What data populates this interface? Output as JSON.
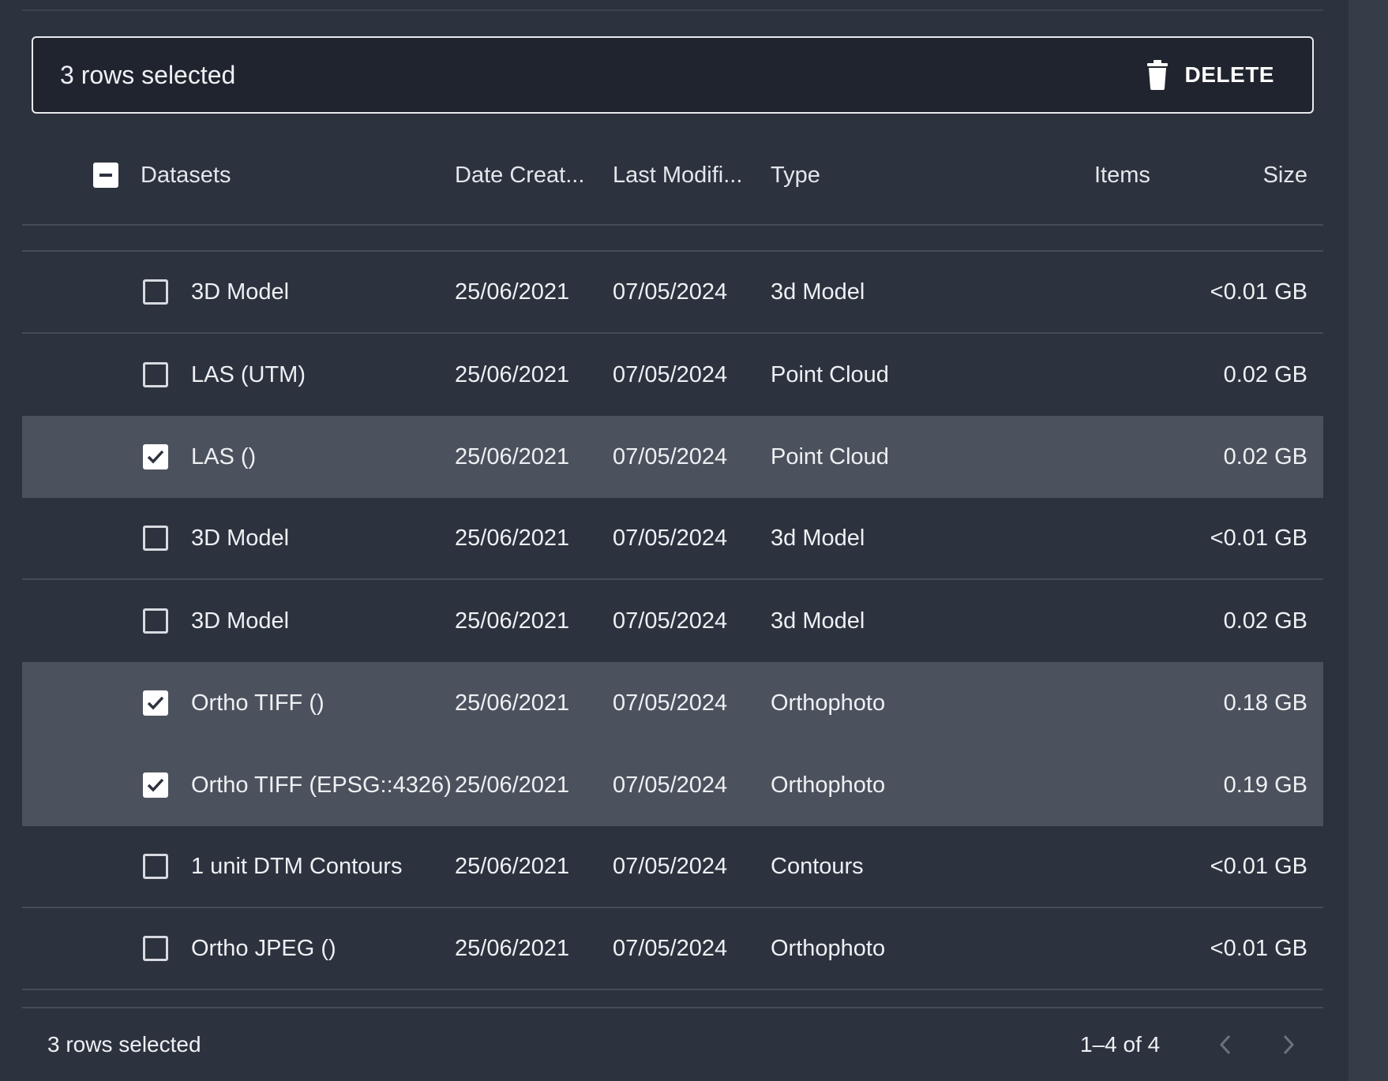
{
  "selection_bar": {
    "text": "3 rows selected",
    "delete_label": "DELETE"
  },
  "table": {
    "headers": {
      "name": "Datasets",
      "date_created": "Date Creat...",
      "last_modified": "Last Modifi...",
      "type": "Type",
      "items": "Items",
      "size": "Size"
    },
    "header_checkbox_state": "indeterminate",
    "rows": [
      {
        "name": "3D Model",
        "date_created": "25/06/2021",
        "last_modified": "07/05/2024",
        "type": "3d Model",
        "items": "",
        "size": "<0.01 GB",
        "selected": false
      },
      {
        "name": "LAS (UTM)",
        "date_created": "25/06/2021",
        "last_modified": "07/05/2024",
        "type": "Point Cloud",
        "items": "",
        "size": "0.02 GB",
        "selected": false
      },
      {
        "name": "LAS ()",
        "date_created": "25/06/2021",
        "last_modified": "07/05/2024",
        "type": "Point Cloud",
        "items": "",
        "size": "0.02 GB",
        "selected": true
      },
      {
        "name": "3D Model",
        "date_created": "25/06/2021",
        "last_modified": "07/05/2024",
        "type": "3d Model",
        "items": "",
        "size": "<0.01 GB",
        "selected": false
      },
      {
        "name": "3D Model",
        "date_created": "25/06/2021",
        "last_modified": "07/05/2024",
        "type": "3d Model",
        "items": "",
        "size": "0.02 GB",
        "selected": false
      },
      {
        "name": "Ortho TIFF ()",
        "date_created": "25/06/2021",
        "last_modified": "07/05/2024",
        "type": "Orthophoto",
        "items": "",
        "size": "0.18 GB",
        "selected": true
      },
      {
        "name": "Ortho TIFF (EPSG::4326)",
        "date_created": "25/06/2021",
        "last_modified": "07/05/2024",
        "type": "Orthophoto",
        "items": "",
        "size": "0.19 GB",
        "selected": true
      },
      {
        "name": "1 unit DTM Contours",
        "date_created": "25/06/2021",
        "last_modified": "07/05/2024",
        "type": "Contours",
        "items": "",
        "size": "<0.01 GB",
        "selected": false
      },
      {
        "name": "Ortho JPEG ()",
        "date_created": "25/06/2021",
        "last_modified": "07/05/2024",
        "type": "Orthophoto",
        "items": "",
        "size": "<0.01 GB",
        "selected": false
      }
    ]
  },
  "footer": {
    "selected_text": "3 rows selected",
    "page_info": "1–4 of 4"
  },
  "icons": {
    "delete": "trash-icon",
    "prev": "chevron-left-icon",
    "next": "chevron-right-icon",
    "checked": "check-icon",
    "indeterminate": "minus-icon"
  },
  "colors": {
    "background": "#2c323e",
    "selection_bar": "#1f242e",
    "selected_row": "#4c525d",
    "divider": "#454b57",
    "text": "#eef0f3"
  }
}
